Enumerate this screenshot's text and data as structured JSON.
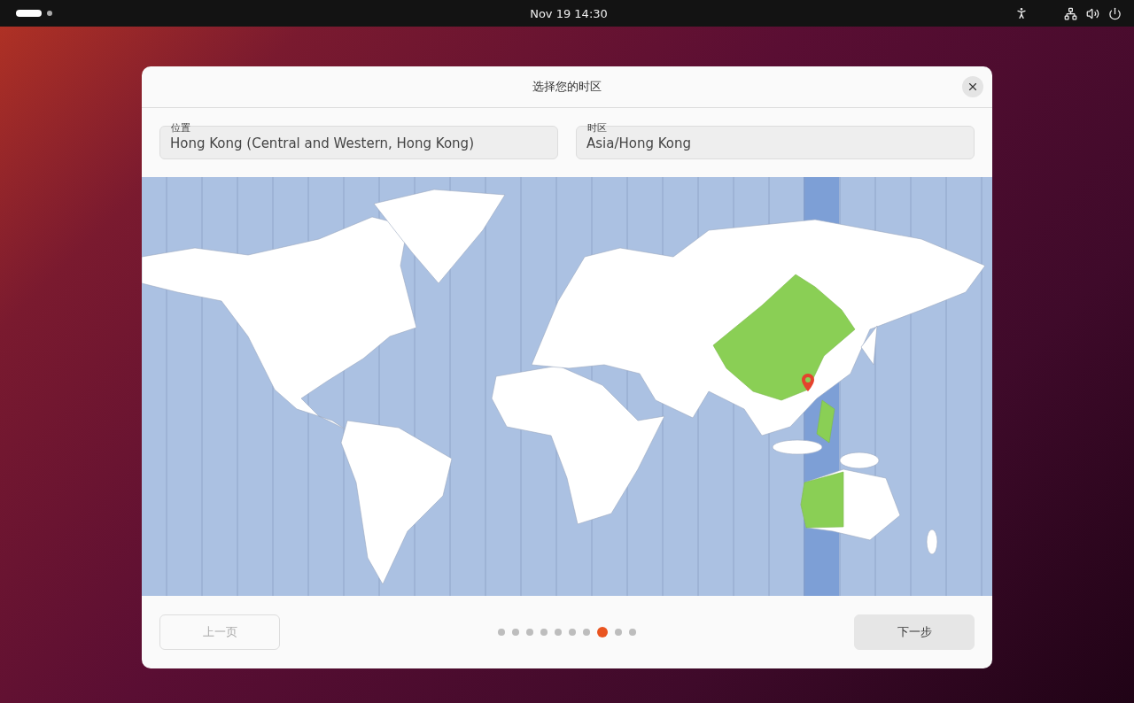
{
  "top_bar": {
    "clock": "Nov 19  14:30"
  },
  "dialog": {
    "title": "选择您的时区",
    "fields": [
      {
        "label": "位置",
        "value": "Hong Kong (Central and Western, Hong Kong)"
      },
      {
        "label": "时区",
        "value": "Asia/Hong Kong"
      }
    ],
    "buttons": [
      {
        "label": "上一页",
        "disabled": true
      },
      {
        "label": "下一步",
        "disabled": false
      }
    ],
    "steps": [
      {
        "selected": false
      },
      {
        "selected": false
      },
      {
        "selected": false
      },
      {
        "selected": false
      },
      {
        "selected": false
      },
      {
        "selected": false
      },
      {
        "selected": false
      },
      {
        "selected": true
      },
      {
        "selected": false
      },
      {
        "selected": false
      }
    ]
  }
}
